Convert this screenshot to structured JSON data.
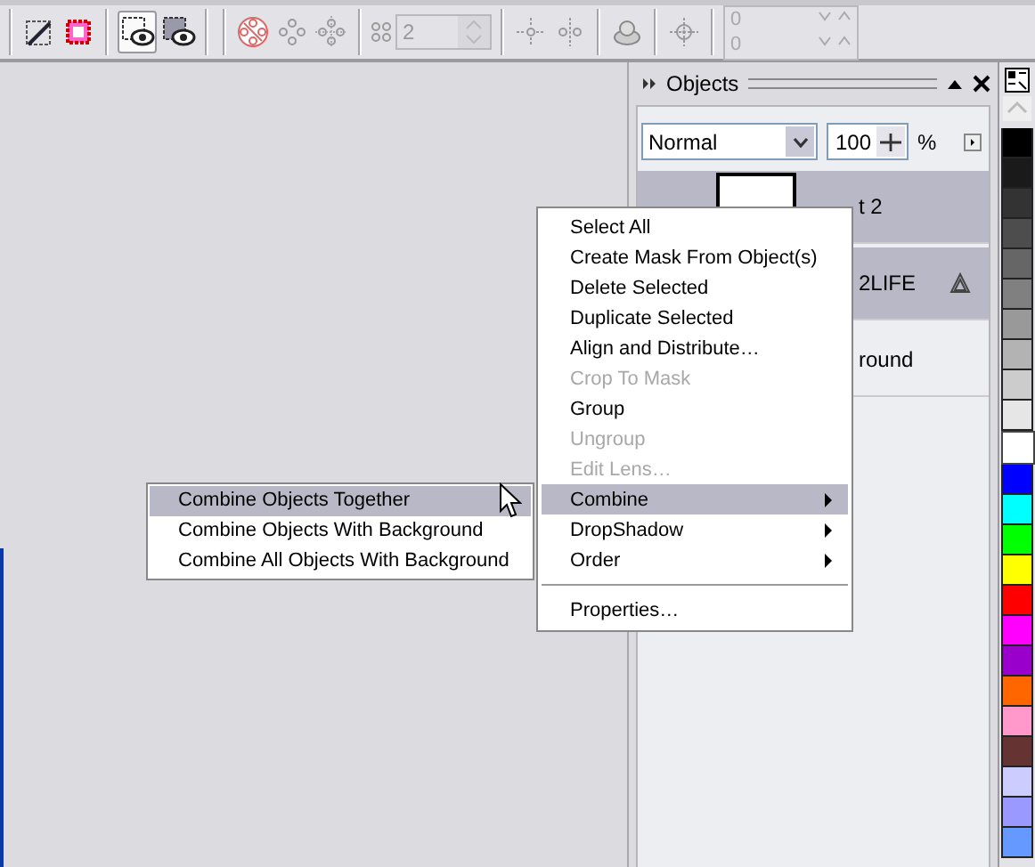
{
  "toolbar": {
    "view_buttons": [
      {
        "selected": true
      },
      {
        "selected": false
      }
    ],
    "count_field": {
      "value": "2",
      "disabled": true
    },
    "position_fields": [
      {
        "value": "0"
      },
      {
        "value": "0"
      }
    ]
  },
  "docker": {
    "title": "Objects",
    "blend_mode": "Normal",
    "opacity": "100",
    "opacity_unit": "%",
    "layers": [
      {
        "name": "t 2",
        "selected": true,
        "kind": "bitmap"
      },
      {
        "name": "2LIFE",
        "selected": true,
        "kind": "lens"
      },
      {
        "name": "round",
        "selected": false,
        "kind": "object"
      }
    ]
  },
  "palette": [
    {
      "color": "#000000",
      "selected": false
    },
    {
      "color": "#1a1a1a",
      "selected": false
    },
    {
      "color": "#333333",
      "selected": false
    },
    {
      "color": "#4d4d4d",
      "selected": false
    },
    {
      "color": "#666666",
      "selected": false
    },
    {
      "color": "#808080",
      "selected": false
    },
    {
      "color": "#999999",
      "selected": false
    },
    {
      "color": "#b3b3b3",
      "selected": false
    },
    {
      "color": "#cccccc",
      "selected": false
    },
    {
      "color": "#e6e6e6",
      "selected": false
    },
    {
      "color": "#ffffff",
      "selected": true
    },
    {
      "color": "#0000ff",
      "selected": false
    },
    {
      "color": "#00ffff",
      "selected": false
    },
    {
      "color": "#00ff00",
      "selected": false
    },
    {
      "color": "#ffff00",
      "selected": false
    },
    {
      "color": "#ff0000",
      "selected": false
    },
    {
      "color": "#ff00ff",
      "selected": false
    },
    {
      "color": "#9900cc",
      "selected": false
    },
    {
      "color": "#ff6600",
      "selected": false
    },
    {
      "color": "#ff99cc",
      "selected": false
    },
    {
      "color": "#663333",
      "selected": false
    },
    {
      "color": "#ccccff",
      "selected": false
    },
    {
      "color": "#9999ff",
      "selected": false
    },
    {
      "color": "#6699ff",
      "selected": false
    }
  ],
  "context_menu": {
    "items": [
      {
        "kind": "item",
        "label": "Select All",
        "disabled": false,
        "selected": false,
        "submenu": false
      },
      {
        "kind": "item",
        "label": "Create Mask From Object(s)",
        "disabled": false,
        "selected": false,
        "submenu": false
      },
      {
        "kind": "item",
        "label": "Delete Selected",
        "disabled": false,
        "selected": false,
        "submenu": false
      },
      {
        "kind": "item",
        "label": "Duplicate Selected",
        "disabled": false,
        "selected": false,
        "submenu": false
      },
      {
        "kind": "item",
        "label": "Align and Distribute…",
        "disabled": false,
        "selected": false,
        "submenu": false
      },
      {
        "kind": "item",
        "label": "Crop To Mask",
        "disabled": true,
        "selected": false,
        "submenu": false
      },
      {
        "kind": "item",
        "label": "Group",
        "disabled": false,
        "selected": false,
        "submenu": false
      },
      {
        "kind": "item",
        "label": "Ungroup",
        "disabled": true,
        "selected": false,
        "submenu": false
      },
      {
        "kind": "item",
        "label": "Edit Lens…",
        "disabled": true,
        "selected": false,
        "submenu": false
      },
      {
        "kind": "item",
        "label": "Combine",
        "disabled": false,
        "selected": true,
        "submenu": true
      },
      {
        "kind": "item",
        "label": "DropShadow",
        "disabled": false,
        "selected": false,
        "submenu": true
      },
      {
        "kind": "item",
        "label": "Order",
        "disabled": false,
        "selected": false,
        "submenu": true
      },
      {
        "kind": "separator"
      },
      {
        "kind": "item",
        "label": "Properties…",
        "disabled": false,
        "selected": false,
        "submenu": false
      }
    ]
  },
  "submenu": {
    "items": [
      {
        "label": "Combine Objects Together",
        "selected": true
      },
      {
        "label": "Combine Objects With Background",
        "selected": false
      },
      {
        "label": "Combine All Objects With Background",
        "selected": false
      }
    ]
  }
}
